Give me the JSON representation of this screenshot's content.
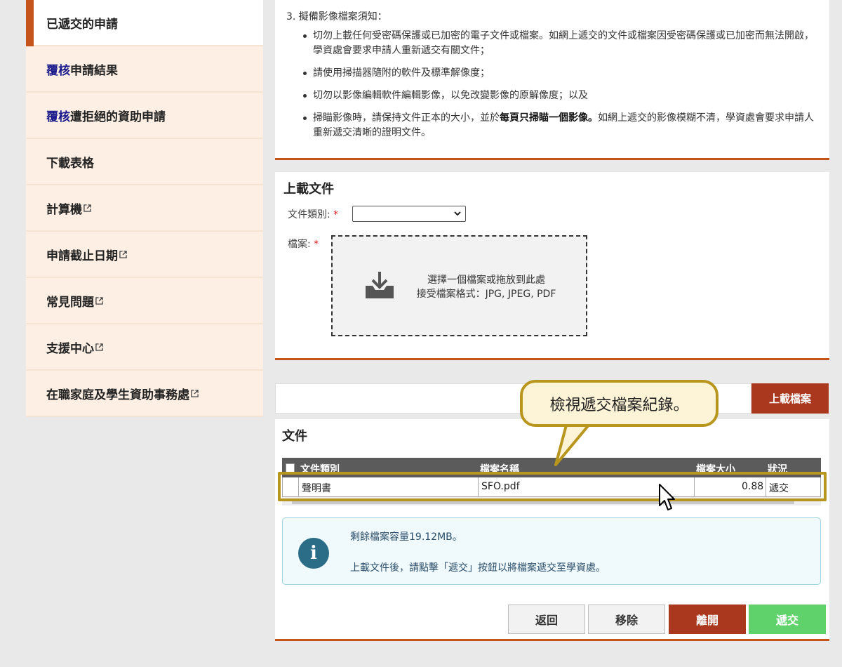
{
  "sidebar": {
    "items": [
      {
        "label": "已遞交的申請",
        "hl": "",
        "ext": false
      },
      {
        "label": "申請結果",
        "hl": "覆核",
        "ext": false
      },
      {
        "label": "遭拒絕的資助申請",
        "hl": "覆核",
        "ext": false
      },
      {
        "label": "下載表格",
        "hl": "",
        "ext": false
      },
      {
        "label": "計算機",
        "hl": "",
        "ext": true
      },
      {
        "label": "申請截止日期",
        "hl": "",
        "ext": true
      },
      {
        "label": "常見問題",
        "hl": "",
        "ext": true
      },
      {
        "label": "支援中心",
        "hl": "",
        "ext": true
      },
      {
        "label": "在職家庭及學生資助事務處",
        "hl": "",
        "ext": true
      }
    ]
  },
  "notes": {
    "heading": "3. 擬備影像檔案須知：",
    "b1": "切勿上載任何受密碼保護或已加密的電子文件或檔案。如網上遞交的文件或檔案因受密碼保護或已加密而無法開啟，學資處會要求申請人重新遞交有關文件；",
    "b2": "請使用掃描器隨附的軟件及標準解像度；",
    "b3": "切勿以影像編輯軟件編輯影像，以免改變影像的原解像度；以及",
    "b4_pre": "掃瞄影像時，請保持文件正本的大小，並於",
    "b4_bold": "每頁只掃瞄一個影像。",
    "b4_post": "如網上遞交的影像模糊不清，學資處會要求申請人重新遞交清晰的證明文件。"
  },
  "upload": {
    "title": "上載文件",
    "doc_type_label": "文件類別: ",
    "file_label": "檔案: ",
    "required_mark": "*",
    "select_value": "",
    "drop_line1": "選擇一個檔案或拖放到此處",
    "drop_line2": "接受檔案格式：JPG, JPEG, PDF",
    "upload_button": "上載檔案"
  },
  "documents": {
    "title": "文件",
    "headers": {
      "type": "文件類別",
      "name": "檔案名稱",
      "size": "檔案大小",
      "status": "狀況"
    },
    "row": {
      "type": "聲明書",
      "name": "SFO.pdf",
      "size": "0.88",
      "status": "遞交"
    },
    "info_line1": "剩餘檔案容量19.12MB。",
    "info_line2": "上載文件後，請點擊「遞交」按鈕以將檔案遞交至學資處。",
    "buttons": {
      "back": "返回",
      "remove": "移除",
      "leave": "離開",
      "submit": "遞交"
    }
  },
  "callout": {
    "text": "檢視遞交檔案紀錄。"
  },
  "colors": {
    "accent": "#c4531c",
    "primary_button": "#a9381f",
    "submit_button": "#5fd26b",
    "callout_border": "#b8961e"
  }
}
